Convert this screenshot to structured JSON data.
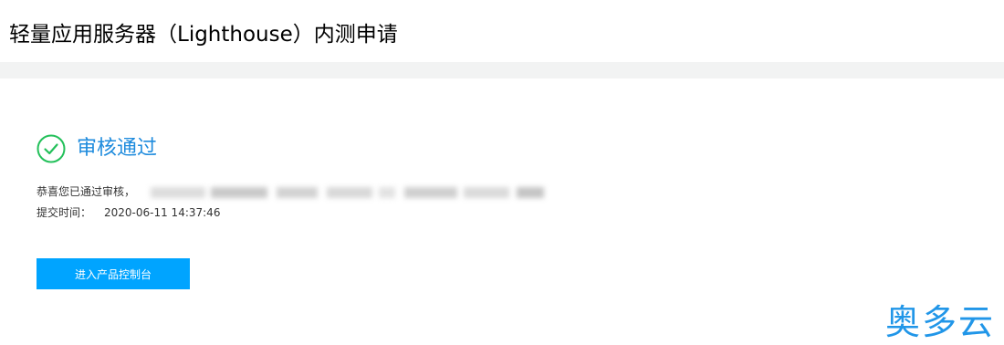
{
  "header": {
    "title": "轻量应用服务器（Lighthouse）内测申请"
  },
  "status": {
    "icon": "check-circle-icon",
    "title": "审核通过"
  },
  "message": {
    "text": "恭喜您已通过审核，",
    "redacted_icon": "redacted-text"
  },
  "submit_time": {
    "label": "提交时间：",
    "value": "2020-06-11 14:37:46"
  },
  "action": {
    "button_label": "进入产品控制台"
  },
  "watermark": {
    "text": "奥多云"
  },
  "colors": {
    "success_green": "#23c05a",
    "status_blue": "#1e8bdd",
    "button_blue": "#00a4ff",
    "watermark_blue": "#2196e8",
    "divider_gray": "#f2f3f3"
  }
}
